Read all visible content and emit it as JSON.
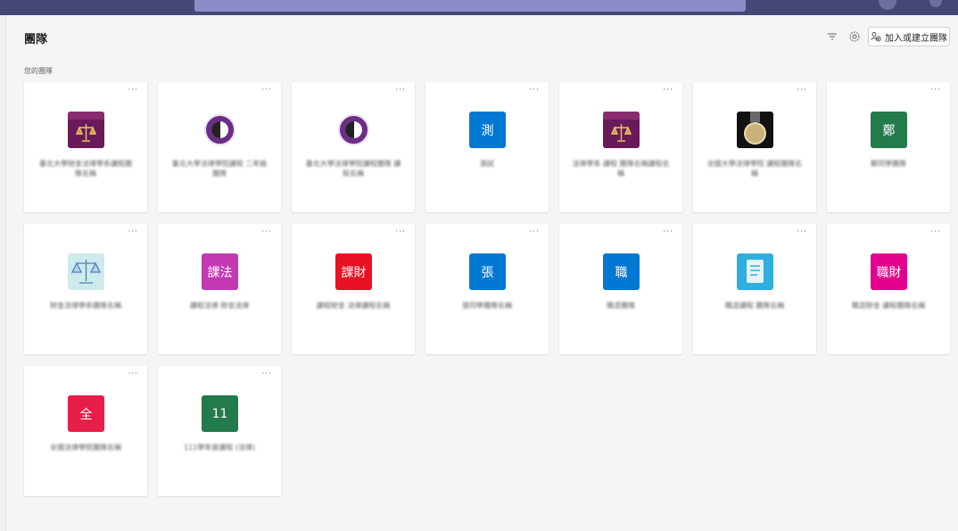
{
  "header": {
    "title": "團隊",
    "section_label": "您的團隊",
    "join_button_label": "加入或建立團隊"
  },
  "colors": {
    "topbar": "#464775",
    "blue": "#0078d4",
    "green": "#237b4b",
    "magenta": "#c239b3",
    "red": "#e81123",
    "pink": "#e3008c",
    "crimson": "#e81e49"
  },
  "teams": [
    {
      "tile_text": "",
      "logo": "university-crest-icon",
      "name": "臺北大學財金法律學系課程團隊名稱"
    },
    {
      "tile_text": "",
      "logo": "university-seal-icon",
      "name": "臺北大學法律學院課程 二年級團隊"
    },
    {
      "tile_text": "",
      "logo": "university-seal-icon",
      "name": "臺北大學法律學院課程團隊 課程名稱"
    },
    {
      "tile_text": "測",
      "color": "#0078d4",
      "name": "測試"
    },
    {
      "tile_text": "",
      "logo": "university-crest-icon",
      "name": "法律學系 課程 團隊名稱課程名稱"
    },
    {
      "tile_text": "",
      "logo": "medal-icon",
      "name": "全國大學法律學院 課程團隊名稱"
    },
    {
      "tile_text": "鄭",
      "color": "#237b4b",
      "name": "鄭同學團隊"
    },
    {
      "tile_text": "",
      "logo": "scales-icon",
      "name": "財金法律學系團隊名稱"
    },
    {
      "tile_text": "課法",
      "color": "#c239b3",
      "name": "課程法律 財金法律"
    },
    {
      "tile_text": "課財",
      "color": "#e81123",
      "name": "課程財金 法律課程名稱"
    },
    {
      "tile_text": "張",
      "color": "#0078d4",
      "name": "張同學團隊名稱"
    },
    {
      "tile_text": "職",
      "color": "#0078d4",
      "name": "職涯團隊"
    },
    {
      "tile_text": "",
      "logo": "document-icon",
      "name": "職涯課程 團隊名稱"
    },
    {
      "tile_text": "職財",
      "color": "#e3008c",
      "name": "職涯財金 課程團隊名稱"
    },
    {
      "tile_text": "全",
      "color": "#e81e49",
      "name": "全國法律學院團隊名稱"
    },
    {
      "tile_text": "11",
      "color": "#237b4b",
      "name": "111學年度課程 (法律)"
    }
  ]
}
